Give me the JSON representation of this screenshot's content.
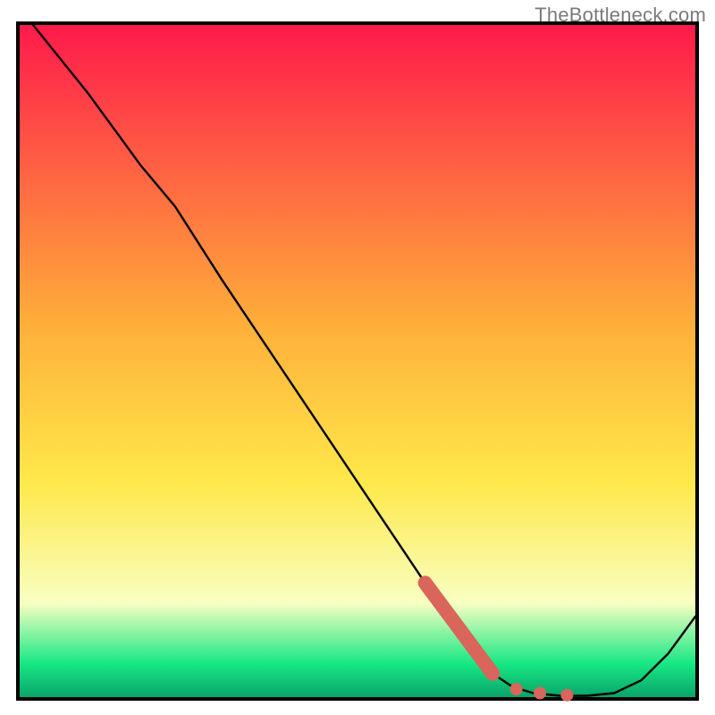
{
  "watermark": "TheBottleneck.com",
  "colors": {
    "border": "#000000",
    "curve": "#000000",
    "marker": "#d9655b",
    "grad_top": "#ff1a4b",
    "grad_mid1": "#ffb03a",
    "grad_mid2": "#ffe84a",
    "grad_pale": "#f8ffc2",
    "grad_green": "#17e884",
    "grad_deep": "#0aa46a"
  },
  "chart_data": {
    "type": "line",
    "title": "",
    "xlabel": "",
    "ylabel": "",
    "xlim": [
      0,
      100
    ],
    "ylim": [
      0,
      100
    ],
    "grid": false,
    "legend": false,
    "series": [
      {
        "name": "curve",
        "x": [
          2,
          10,
          18,
          23,
          30,
          40,
          50,
          60,
          66,
          70,
          73,
          76,
          80,
          84,
          88,
          92,
          96,
          100
        ],
        "y": [
          100,
          90,
          79,
          73,
          62,
          47,
          32,
          17,
          8,
          3.5,
          1.5,
          0.6,
          0.2,
          0.2,
          0.6,
          2.5,
          6.5,
          12
        ]
      }
    ],
    "markers": {
      "name": "highlight-dots",
      "segment_start": {
        "x": 60,
        "y": 17
      },
      "segment_end": {
        "x": 70,
        "y": 3.5
      },
      "dots": [
        {
          "x": 73.5,
          "y": 1.2
        },
        {
          "x": 77,
          "y": 0.6
        },
        {
          "x": 81,
          "y": 0.3
        }
      ]
    }
  }
}
